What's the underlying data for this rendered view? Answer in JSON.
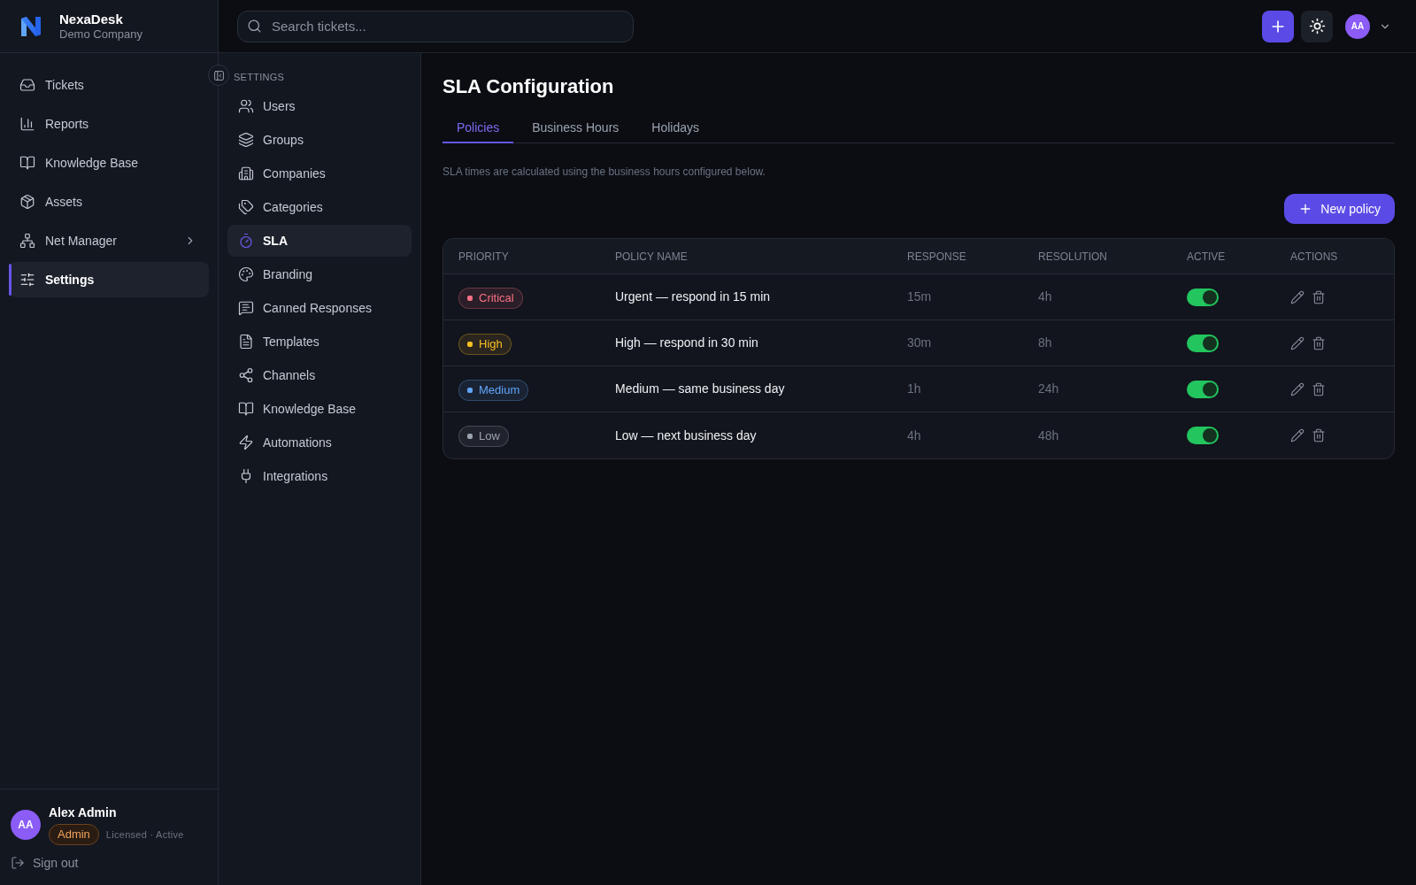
{
  "brand": {
    "name": "NexaDesk",
    "subtitle": "Demo Company"
  },
  "sidebar": {
    "items": [
      {
        "label": "Tickets",
        "kind": "link",
        "selected": false
      },
      {
        "label": "Reports",
        "kind": "link",
        "selected": false
      },
      {
        "label": "Knowledge Base",
        "kind": "link",
        "selected": false
      },
      {
        "label": "Assets",
        "kind": "link",
        "selected": false
      },
      {
        "label": "Net Manager",
        "kind": "group",
        "selected": false
      },
      {
        "label": "Settings",
        "kind": "link",
        "selected": true
      }
    ],
    "user": {
      "initials": "AA",
      "name": "Alex Admin",
      "role": "Admin",
      "license": "Licensed · Active"
    },
    "sign_out": "Sign out"
  },
  "header": {
    "search": {
      "placeholder": "Search tickets..."
    },
    "avatar": "AA"
  },
  "settings_nav": {
    "heading": "SETTINGS",
    "items": [
      {
        "label": "Users",
        "selected": false
      },
      {
        "label": "Groups",
        "selected": false
      },
      {
        "label": "Companies",
        "selected": false
      },
      {
        "label": "Categories",
        "selected": false
      },
      {
        "label": "SLA",
        "selected": true
      },
      {
        "label": "Branding",
        "selected": false
      },
      {
        "label": "Canned Responses",
        "selected": false
      },
      {
        "label": "Templates",
        "selected": false
      },
      {
        "label": "Channels",
        "selected": false
      },
      {
        "label": "Knowledge Base",
        "selected": false
      },
      {
        "label": "Automations",
        "selected": false
      },
      {
        "label": "Integrations",
        "selected": false
      }
    ]
  },
  "page": {
    "title": "SLA Configuration",
    "tabs": [
      {
        "label": "Policies",
        "selected": true
      },
      {
        "label": "Business Hours",
        "selected": false
      },
      {
        "label": "Holidays",
        "selected": false
      }
    ],
    "description": "SLA times are calculated using the business hours configured below.",
    "new_policy": "New policy"
  },
  "table": {
    "columns": [
      "PRIORITY",
      "POLICY NAME",
      "RESPONSE",
      "RESOLUTION",
      "ACTIVE",
      "ACTIONS"
    ],
    "rows": [
      {
        "priority": "Critical",
        "color": "#fb7185",
        "policy_name": "Urgent — respond in 15 min",
        "response": "15m",
        "resolution": "4h",
        "active": true
      },
      {
        "priority": "High",
        "color": "#fbbf24",
        "policy_name": "High — respond in 30 min",
        "response": "30m",
        "resolution": "8h",
        "active": true
      },
      {
        "priority": "Medium",
        "color": "#60a5fa",
        "policy_name": "Medium — same business day",
        "response": "1h",
        "resolution": "24h",
        "active": true
      },
      {
        "priority": "Low",
        "color": "#9ca3af",
        "policy_name": "Low — next business day",
        "response": "4h",
        "resolution": "48h",
        "active": true
      }
    ]
  }
}
